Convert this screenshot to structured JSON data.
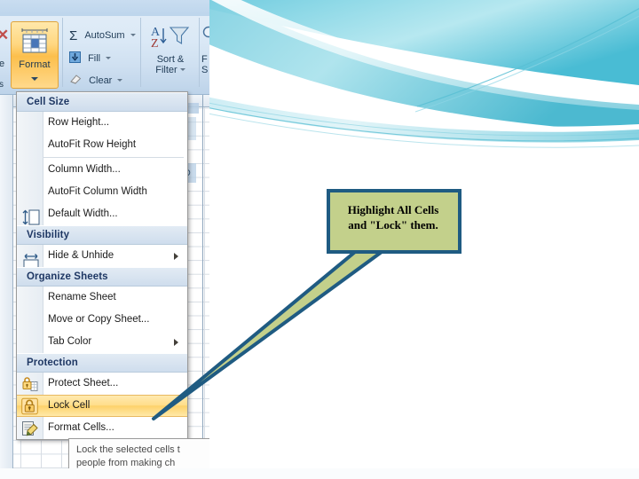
{
  "slide": {
    "background_style": "teal-wave-swoosh",
    "colors": {
      "wave_dark_teal": "#3fb2cd",
      "wave_mid_teal": "#7fd2e3",
      "wave_light_teal": "#c9ecf3",
      "callout_fill": "#c3d08b",
      "callout_border": "#1f5b82",
      "highlight_amber": "#ffd780",
      "menu_header_blue": "#1f3864"
    }
  },
  "callout": {
    "name": "speech-callout",
    "line1": "Highlight All Cells",
    "line2": "and \"Lock\" them.",
    "fill": "#c3d08b",
    "border": "#1f5b82",
    "pointer_target": "Lock Cell"
  },
  "excel": {
    "ribbon": {
      "format_button": {
        "label": "Format",
        "icon": "format-cells-icon",
        "has_dropdown": true
      },
      "paste_label": "te",
      "styles_label": "s",
      "editing_group": [
        {
          "label": "AutoSum",
          "icon": "sigma-icon",
          "has_dropdown": true
        },
        {
          "label": "Fill",
          "icon": "fill-down-icon",
          "has_dropdown": true
        },
        {
          "label": "Clear",
          "icon": "eraser-icon",
          "has_dropdown": true
        }
      ],
      "sort_filter": {
        "line1": "Sort &",
        "line2": "Filter",
        "icon": "sort-filter-icon",
        "has_dropdown": true
      },
      "find_select": {
        "line1": "F",
        "line2": "S",
        "icon": "find-select-icon"
      }
    },
    "menu": {
      "name": "format-dropdown-menu",
      "groups": [
        {
          "header": "Cell Size",
          "icons": [
            "row-height-icon",
            "column-width-icon"
          ],
          "items": [
            {
              "label": "Row Height...",
              "accel": "H",
              "submenu": false
            },
            {
              "label": "AutoFit Row Height",
              "accel": "A",
              "submenu": false
            },
            {
              "label": "Column Width...",
              "accel": "W",
              "submenu": false
            },
            {
              "label": "AutoFit Column Width",
              "accel": "i",
              "submenu": false
            },
            {
              "label": "Default Width...",
              "accel": "D",
              "submenu": false
            }
          ]
        },
        {
          "header": "Visibility",
          "icons": [],
          "items": [
            {
              "label": "Hide & Unhide",
              "accel": "U",
              "submenu": true
            }
          ]
        },
        {
          "header": "Organize Sheets",
          "icons": [],
          "items": [
            {
              "label": "Rename Sheet",
              "accel": "R",
              "submenu": false
            },
            {
              "label": "Move or Copy Sheet...",
              "accel": "M",
              "submenu": false
            },
            {
              "label": "Tab Color",
              "accel": "T",
              "submenu": true
            }
          ]
        },
        {
          "header": "Protection",
          "icons": [],
          "items": [
            {
              "label": "Protect Sheet...",
              "accel": "P",
              "icon": "protect-sheet-lock-icon",
              "submenu": false
            },
            {
              "label": "Lock Cell",
              "accel": "L",
              "icon": "lock-cell-icon",
              "submenu": false,
              "selected": true
            },
            {
              "label": "Format Cells...",
              "accel": "E",
              "icon": "format-cells-dialog-icon",
              "submenu": false
            }
          ]
        }
      ]
    },
    "tooltip": {
      "name": "lock-cell-tooltip",
      "line1": "Lock the selected cells t",
      "line2": "people from making ch"
    }
  }
}
